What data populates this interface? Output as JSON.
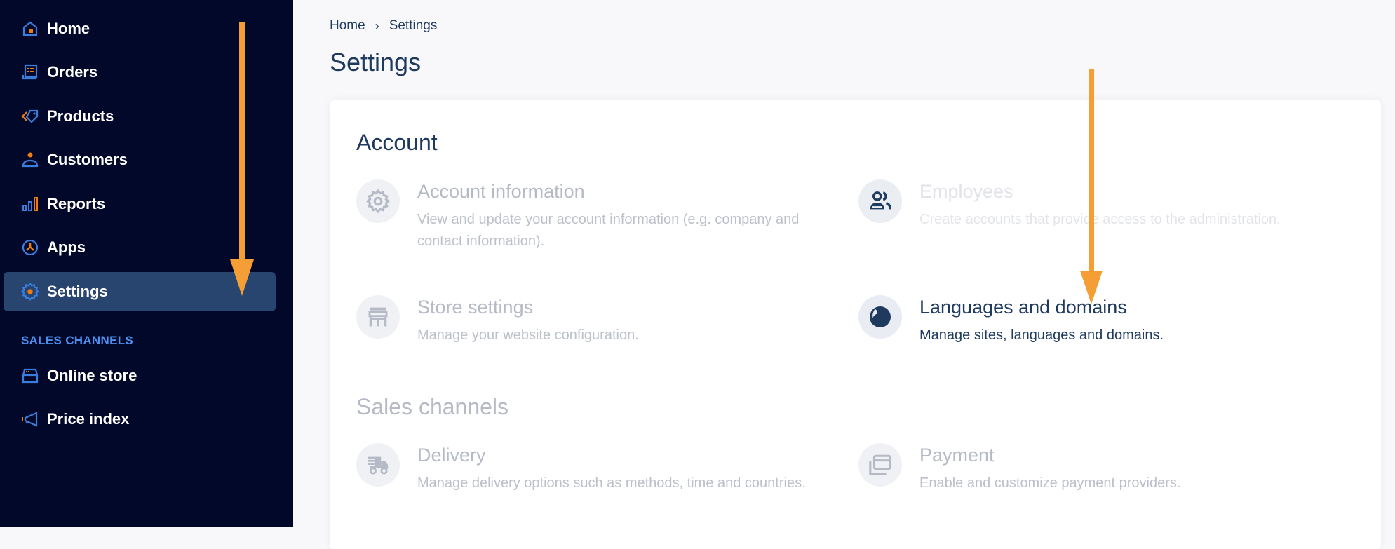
{
  "sidebar": {
    "items": [
      {
        "label": "Home",
        "icon": "home-icon"
      },
      {
        "label": "Orders",
        "icon": "orders-icon"
      },
      {
        "label": "Products",
        "icon": "tag-icon"
      },
      {
        "label": "Customers",
        "icon": "person-icon"
      },
      {
        "label": "Reports",
        "icon": "bar-chart-icon"
      },
      {
        "label": "Apps",
        "icon": "apps-icon"
      },
      {
        "label": "Settings",
        "icon": "gear-icon",
        "active": true
      }
    ],
    "section_label": "SALES CHANNELS",
    "channels": [
      {
        "label": "Online store",
        "icon": "storefront-icon"
      },
      {
        "label": "Price index",
        "icon": "megaphone-icon"
      }
    ]
  },
  "breadcrumb": {
    "home": "Home",
    "separator": "›",
    "current": "Settings"
  },
  "page": {
    "title": "Settings"
  },
  "sections": {
    "account": {
      "heading": "Account",
      "items": [
        {
          "title": "Account information",
          "description": "View and update your account information (e.g. company and contact information).",
          "icon": "gear-icon"
        },
        {
          "title": "Employees",
          "description": "Create accounts that provide access to the administration.",
          "icon": "people-icon"
        },
        {
          "title": "Store settings",
          "description": "Manage your website configuration.",
          "icon": "store-icon"
        },
        {
          "title": "Languages and domains",
          "description": "Manage sites, languages and domains.",
          "icon": "globe-icon"
        }
      ]
    },
    "sales_channels": {
      "heading": "Sales channels",
      "items": [
        {
          "title": "Delivery",
          "description": "Manage delivery options such as methods, time and countries.",
          "icon": "truck-icon"
        },
        {
          "title": "Payment",
          "description": "Enable and customize payment providers.",
          "icon": "payment-card-icon"
        }
      ]
    }
  },
  "colors": {
    "sidebar_bg": "#020829",
    "sidebar_active": "#27456e",
    "accent_blue": "#3b7ddd",
    "accent_orange": "#f07a14",
    "annotation_arrow": "#f59e35",
    "text_primary": "#1f3a5f"
  }
}
